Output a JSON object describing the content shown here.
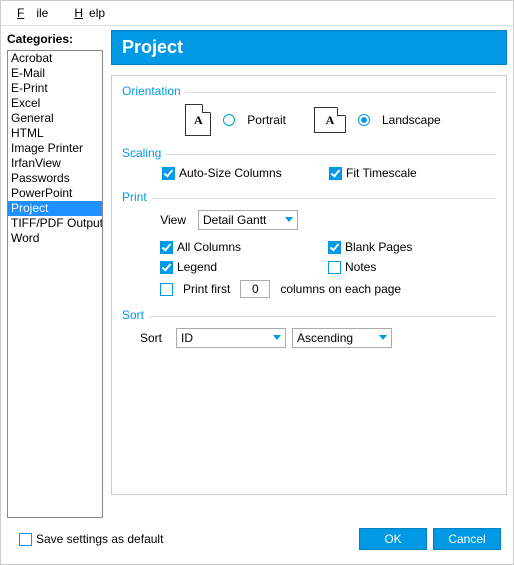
{
  "menu": {
    "file": "File",
    "help": "Help"
  },
  "categories_label": "Categories:",
  "categories": [
    "Acrobat",
    "E-Mail",
    "E-Print",
    "Excel",
    "General",
    "HTML",
    "Image Printer",
    "IrfanView",
    "Passwords",
    "PowerPoint",
    "Project",
    "TIFF/PDF Output",
    "Word"
  ],
  "selected_category_index": 10,
  "banner_title": "Project",
  "orientation": {
    "group_label": "Orientation",
    "portrait_label": "Portrait",
    "landscape_label": "Landscape",
    "value": "landscape"
  },
  "scaling": {
    "group_label": "Scaling",
    "auto_size_label": "Auto-Size Columns",
    "auto_size_checked": true,
    "fit_timescale_label": "Fit Timescale",
    "fit_timescale_checked": true
  },
  "print": {
    "group_label": "Print",
    "view_label": "View",
    "view_value": "Detail Gantt",
    "all_columns_label": "All Columns",
    "all_columns_checked": true,
    "blank_pages_label": "Blank Pages",
    "blank_pages_checked": true,
    "legend_label": "Legend",
    "legend_checked": true,
    "notes_label": "Notes",
    "notes_checked": false,
    "print_first_label": "Print first",
    "print_first_checked": false,
    "print_first_value": "0",
    "print_first_suffix": "columns on each page"
  },
  "sort": {
    "group_label": "Sort",
    "sort_label": "Sort",
    "field_value": "ID",
    "direction_value": "Ascending"
  },
  "footer": {
    "save_default_label": "Save settings as default",
    "save_default_checked": false,
    "ok": "OK",
    "cancel": "Cancel"
  }
}
